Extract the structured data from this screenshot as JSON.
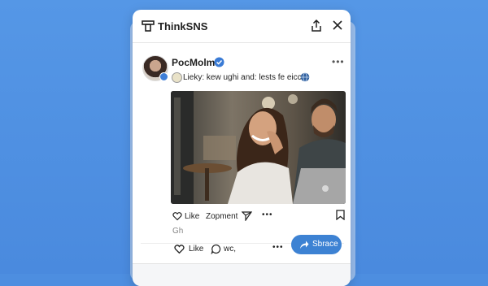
{
  "app": {
    "title": "ThinkSNS"
  },
  "post": {
    "author": "PocMolma",
    "subtitle": "Lieky: kew ughi and: lests fe eicc",
    "actions": {
      "like": "Like",
      "comment": "Zopment"
    },
    "caption": "Gh"
  },
  "footer": {
    "like": "Like",
    "comment": "wc,",
    "share": "Sbrace"
  },
  "icons": [
    "app-logo-icon",
    "share-icon",
    "close-icon",
    "verified-icon",
    "more-icon",
    "globe-icon",
    "heart-icon",
    "send-icon",
    "bookmark-icon",
    "comment-icon"
  ],
  "colors": {
    "background": "#4d8ee0",
    "accent": "#3d82d3",
    "card": "#ffffff"
  }
}
